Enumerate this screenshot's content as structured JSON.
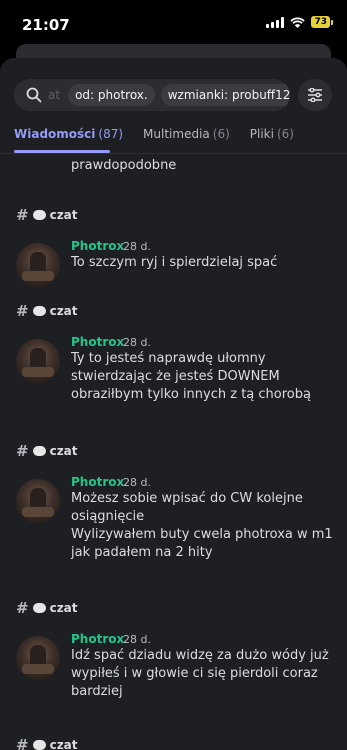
{
  "status_bar": {
    "time": "21:07",
    "battery": "73"
  },
  "search": {
    "placeholder": "at",
    "chips": [
      "od: photrox.",
      "wzmianki: probuff12"
    ]
  },
  "tabs": [
    {
      "label": "Wiadomości",
      "count": "(87)"
    },
    {
      "label": "Multimedia",
      "count": "(6)"
    },
    {
      "label": "Pliki",
      "count": "(6)"
    }
  ],
  "partial_line": "prawdopodobne",
  "results": [
    {
      "channel": "czat",
      "author": "Photrox",
      "time": "28 d.",
      "lines": [
        "To szczym ryj i spierdzielaj spać"
      ]
    },
    {
      "channel": "czat",
      "author": "Photrox",
      "time": "28 d.",
      "lines": [
        "Ty to jesteś naprawdę ułomny",
        "stwierdzając że jesteś DOWNEM",
        "obraziłbym tylko innych z tą chorobą"
      ]
    },
    {
      "channel": "czat",
      "author": "Photrox",
      "time": "28 d.",
      "lines": [
        "Możesz sobie wpisać do CW kolejne",
        "osiągnięcie",
        "Wylizywałem buty cwela photroxa w m1",
        "jak padałem na 2 hity"
      ]
    },
    {
      "channel": "czat",
      "author": "Photrox",
      "time": "28 d.",
      "lines": [
        "Idź spać dziadu widzę za dużo wódy już",
        "wypiłeś i w głowie ci się pierdoli coraz",
        "bardziej"
      ]
    },
    {
      "channel": "czat"
    }
  ]
}
